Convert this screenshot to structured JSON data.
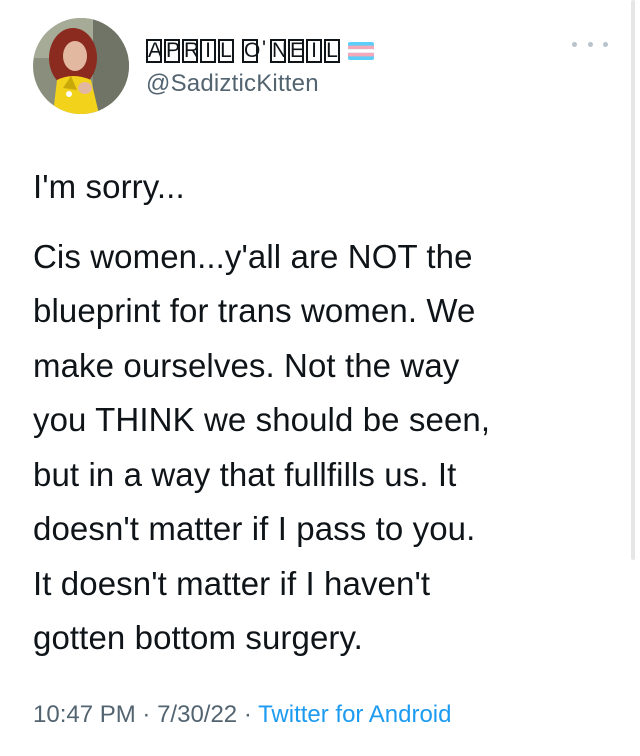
{
  "author": {
    "display_name_letters": [
      "A",
      "P",
      "R",
      "I",
      "L",
      " ",
      "O",
      "'",
      "N",
      "E",
      "I",
      "L"
    ],
    "display_name": "APRIL O'NEIL",
    "handle": "@SadizticKitten",
    "flag": "transgender-flag",
    "avatar": "profile-photo"
  },
  "tweet": {
    "text_line1": "I'm sorry...",
    "text_para2": "Cis women...y'all are NOT the\nblueprint for trans women. We\nmake ourselves. Not the way\nyou THINK we should be seen,\nbut in a way that fullfills us. It\ndoesn't matter if I pass to you.\nIt doesn't matter if I haven't\ngotten bottom surgery."
  },
  "meta": {
    "time": "10:47 PM",
    "separator": "·",
    "date": "7/30/22",
    "source": "Twitter for Android"
  },
  "icons": {
    "more": "more-options-icon"
  },
  "colors": {
    "text": "#0f1419",
    "secondary": "#536471",
    "link": "#1d9bf0",
    "flag_blue": "#5bcefa",
    "flag_pink": "#f5a9b8",
    "flag_white": "#ffffff"
  }
}
